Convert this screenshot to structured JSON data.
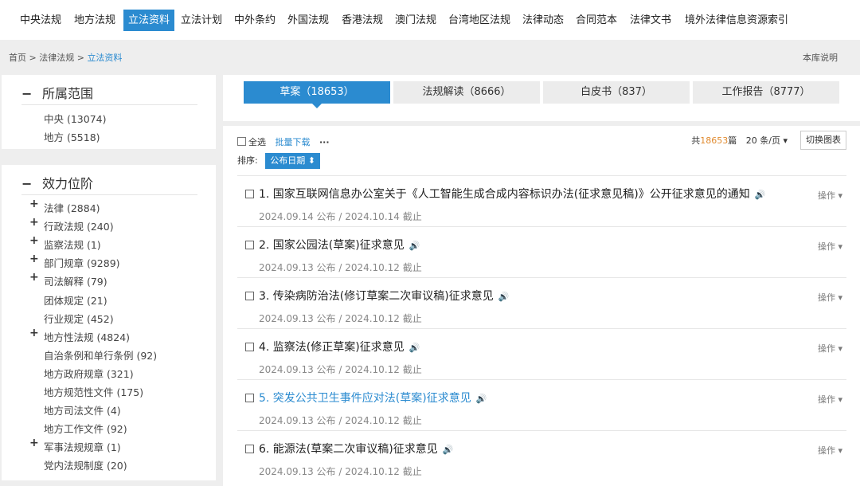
{
  "nav": {
    "items": [
      "中央法规",
      "地方法规",
      "立法资料",
      "立法计划",
      "中外条约",
      "外国法规",
      "香港法规",
      "澳门法规",
      "台湾地区法规",
      "法律动态",
      "合同范本",
      "法律文书",
      "境外法律信息资源索引"
    ],
    "active": "立法资料"
  },
  "breadcrumb": {
    "home": "首页",
    "sep": ">",
    "section": "法律法规",
    "current": "立法资料"
  },
  "library_note": "本库说明",
  "scope": {
    "title": "所属范围",
    "items": [
      "中央 (13074)",
      "地方 (5518)"
    ]
  },
  "rank": {
    "title": "效力位阶",
    "items": [
      {
        "label": "法律 (2884)",
        "expandable": true
      },
      {
        "label": "行政法规 (240)",
        "expandable": true
      },
      {
        "label": "监察法规 (1)",
        "expandable": true
      },
      {
        "label": "部门规章 (9289)",
        "expandable": true
      },
      {
        "label": "司法解释 (79)",
        "expandable": true
      },
      {
        "label": "团体规定 (21)",
        "expandable": false
      },
      {
        "label": "行业规定 (452)",
        "expandable": false
      },
      {
        "label": "地方性法规 (4824)",
        "expandable": true
      },
      {
        "label": "自治条例和单行条例 (92)",
        "expandable": false
      },
      {
        "label": "地方政府规章 (321)",
        "expandable": false
      },
      {
        "label": "地方规范性文件 (175)",
        "expandable": false
      },
      {
        "label": "地方司法文件 (4)",
        "expandable": false
      },
      {
        "label": "地方工作文件 (92)",
        "expandable": false
      },
      {
        "label": "军事法规规章 (1)",
        "expandable": true
      },
      {
        "label": "党内法规制度 (20)",
        "expandable": false
      }
    ]
  },
  "tabs": [
    {
      "label": "草案（18653）",
      "active": true
    },
    {
      "label": "法规解读（8666）",
      "active": false
    },
    {
      "label": "白皮书（837）",
      "active": false
    },
    {
      "label": "工作报告（8777）",
      "active": false
    }
  ],
  "toolbar": {
    "select_all": "全选",
    "batch_download": "批量下载",
    "more": "···",
    "sort_label": "排序:",
    "sort_value": "公布日期 ⬍",
    "total_prefix": "共",
    "total": "18653",
    "total_suffix": "篇",
    "per_page": "20 条/页 ▾",
    "switch_view": "切换图表"
  },
  "results": [
    {
      "title": "1. 国家互联网信息办公室关于《人工智能生成合成内容标识办法(征求意见稿)》公开征求意见的通知",
      "meta": "2024.09.14 公布 / 2024.10.14 截止",
      "highlight": false
    },
    {
      "title": "2. 国家公园法(草案)征求意见",
      "meta": "2024.09.13 公布 / 2024.10.12 截止",
      "highlight": false
    },
    {
      "title": "3. 传染病防治法(修订草案二次审议稿)征求意见",
      "meta": "2024.09.13 公布 / 2024.10.12 截止",
      "highlight": false
    },
    {
      "title": "4. 监察法(修正草案)征求意见",
      "meta": "2024.09.13 公布 / 2024.10.12 截止",
      "highlight": false
    },
    {
      "title": "5. 突发公共卫生事件应对法(草案)征求意见",
      "meta": "2024.09.13 公布 / 2024.10.12 截止",
      "highlight": true
    },
    {
      "title": "6. 能源法(草案二次审议稿)征求意见",
      "meta": "2024.09.13 公布 / 2024.10.12 截止",
      "highlight": false
    }
  ],
  "row_action": "操作 ▾",
  "speaker_icon": "🔊"
}
